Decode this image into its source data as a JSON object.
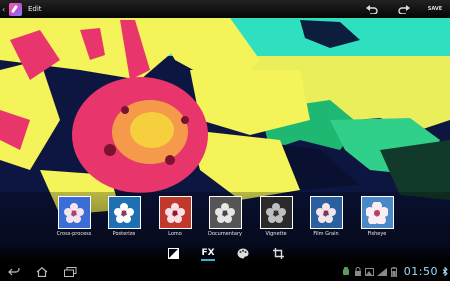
{
  "app": {
    "title": "Edit",
    "save_label": "SAVE"
  },
  "filters": [
    {
      "label": "Cross-process",
      "tint": "#3a6dd6"
    },
    {
      "label": "Posterize",
      "tint": "#1f6fb3"
    },
    {
      "label": "Lomo",
      "tint": "#c0392b"
    },
    {
      "label": "Documentary",
      "tint": "#555555"
    },
    {
      "label": "Vignette",
      "tint": "#2a2a2a"
    },
    {
      "label": "Film Grain",
      "tint": "#2b5f9e"
    },
    {
      "label": "Fisheye",
      "tint": "#4a88c8"
    }
  ],
  "modes": {
    "fx_label": "FX"
  },
  "status": {
    "time": "01:50"
  },
  "colors": {
    "accent": "#33b5e5",
    "sunflower_yellow": "#f4f35a",
    "flower_center": "#e8356b",
    "sky": "#2fe0c0"
  }
}
